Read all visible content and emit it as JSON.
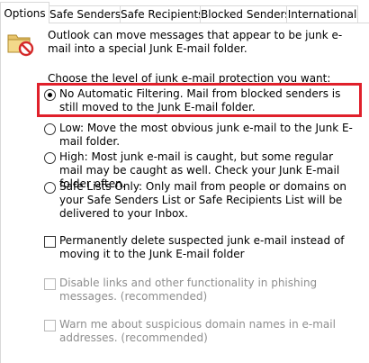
{
  "tabs": [
    {
      "label": "Options",
      "active": true
    },
    {
      "label": "Safe Senders",
      "active": false
    },
    {
      "label": "Safe Recipients",
      "active": false
    },
    {
      "label": "Blocked Senders",
      "active": false
    },
    {
      "label": "International",
      "active": false
    }
  ],
  "intro": {
    "icon": "junk-mail-folder-icon",
    "text": "Outlook can move messages that appear to be junk e-mail into a special Junk E-mail folder."
  },
  "protection": {
    "label": "Choose the level of junk e-mail protection you want:",
    "options": [
      {
        "label": "No Automatic Filtering. Mail from blocked senders is still moved to the Junk E-mail folder.",
        "selected": true
      },
      {
        "label": "Low: Move the most obvious junk e-mail to the Junk E-mail folder.",
        "selected": false
      },
      {
        "label": "High: Most junk e-mail is caught, but some regular mail may be caught as well. Check your Junk E-mail folder often.",
        "selected": false
      },
      {
        "label": "Safe Lists Only: Only mail from people or domains on your Safe Senders List or Safe Recipients List will be delivered to your Inbox.",
        "selected": false
      }
    ]
  },
  "checkboxes": [
    {
      "label": "Permanently delete suspected junk e-mail instead of moving it to the Junk E-mail folder",
      "checked": false,
      "enabled": true
    },
    {
      "label": "Disable links and other functionality in phishing messages. (recommended)",
      "checked": false,
      "enabled": false
    },
    {
      "label": "Warn me about suspicious domain names in e-mail addresses. (recommended)",
      "checked": false,
      "enabled": false
    }
  ],
  "colors": {
    "highlight": "#e0202b",
    "border": "#d9d9d9",
    "disabled_text": "#8e8e8e"
  }
}
